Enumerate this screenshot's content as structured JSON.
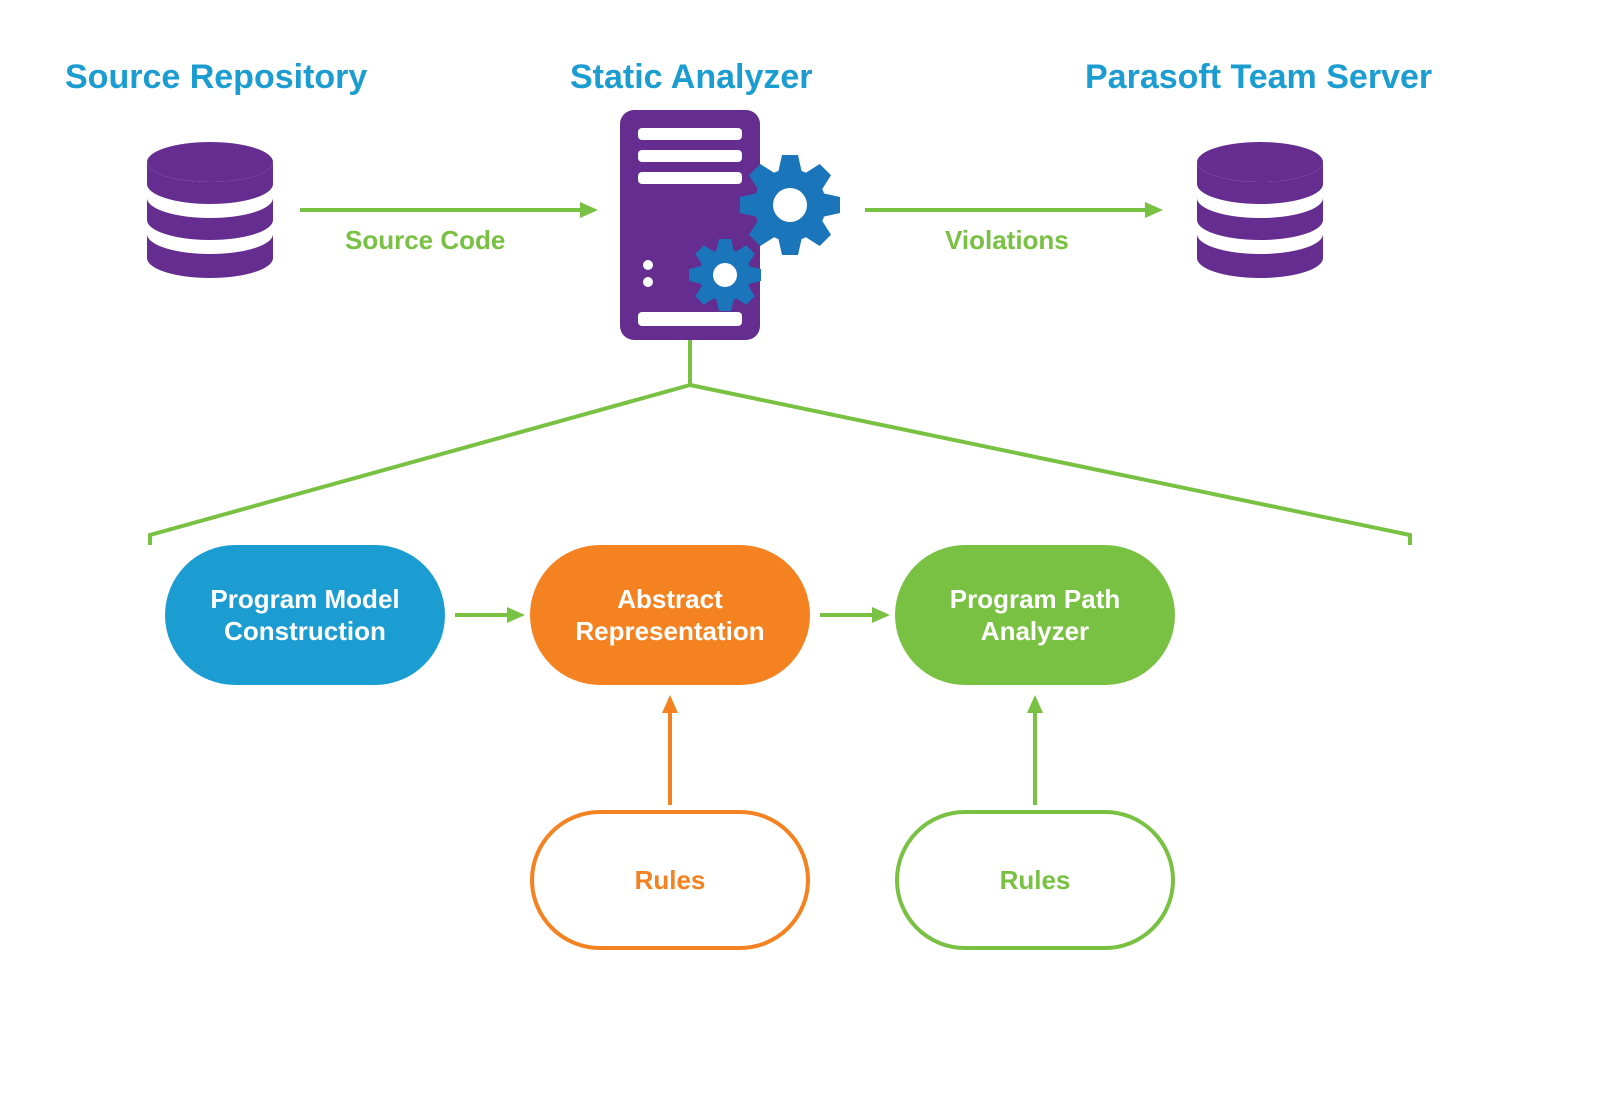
{
  "headings": {
    "source_repo": "Source Repository",
    "static_analyzer": "Static Analyzer",
    "team_server": "Parasoft Team Server"
  },
  "flow_labels": {
    "source_code": "Source Code",
    "violations": "Violations"
  },
  "pills": {
    "program_model": "Program Model Construction",
    "abstract_rep": "Abstract Representation",
    "path_analyzer": "Program Path Analyzer",
    "rules_orange": "Rules",
    "rules_green": "Rules"
  },
  "colors": {
    "heading_blue": "#1b9dd1",
    "flow_green": "#79c142",
    "purple": "#652d90",
    "gear_blue": "#1b75bb",
    "pill_blue": "#1b9dd1",
    "pill_orange": "#f58220",
    "pill_green": "#79c142"
  }
}
